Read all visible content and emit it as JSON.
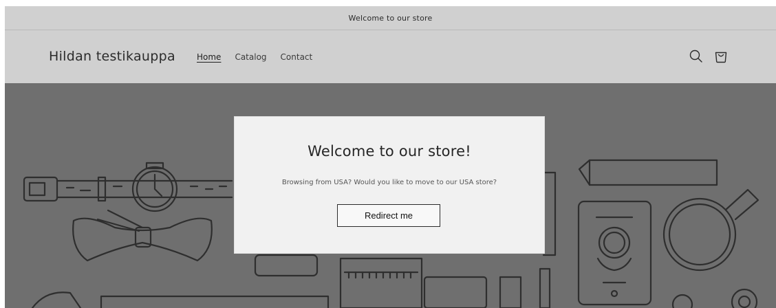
{
  "announcement": {
    "text": "Welcome to our store"
  },
  "header": {
    "logo": "Hildan testikauppa",
    "nav": [
      {
        "label": "Home",
        "active": true
      },
      {
        "label": "Catalog",
        "active": false
      },
      {
        "label": "Contact",
        "active": false
      }
    ],
    "icons": [
      "search-icon",
      "cart-icon"
    ]
  },
  "modal": {
    "title": "Welcome to our store!",
    "text": "Browsing from USA? Would you like to move to our USA store?",
    "button_label": "Redirect me"
  },
  "colors": {
    "header_bg": "#d0d0d0",
    "overlay": "#6f6f6f",
    "modal_bg": "#f1f1f1"
  }
}
